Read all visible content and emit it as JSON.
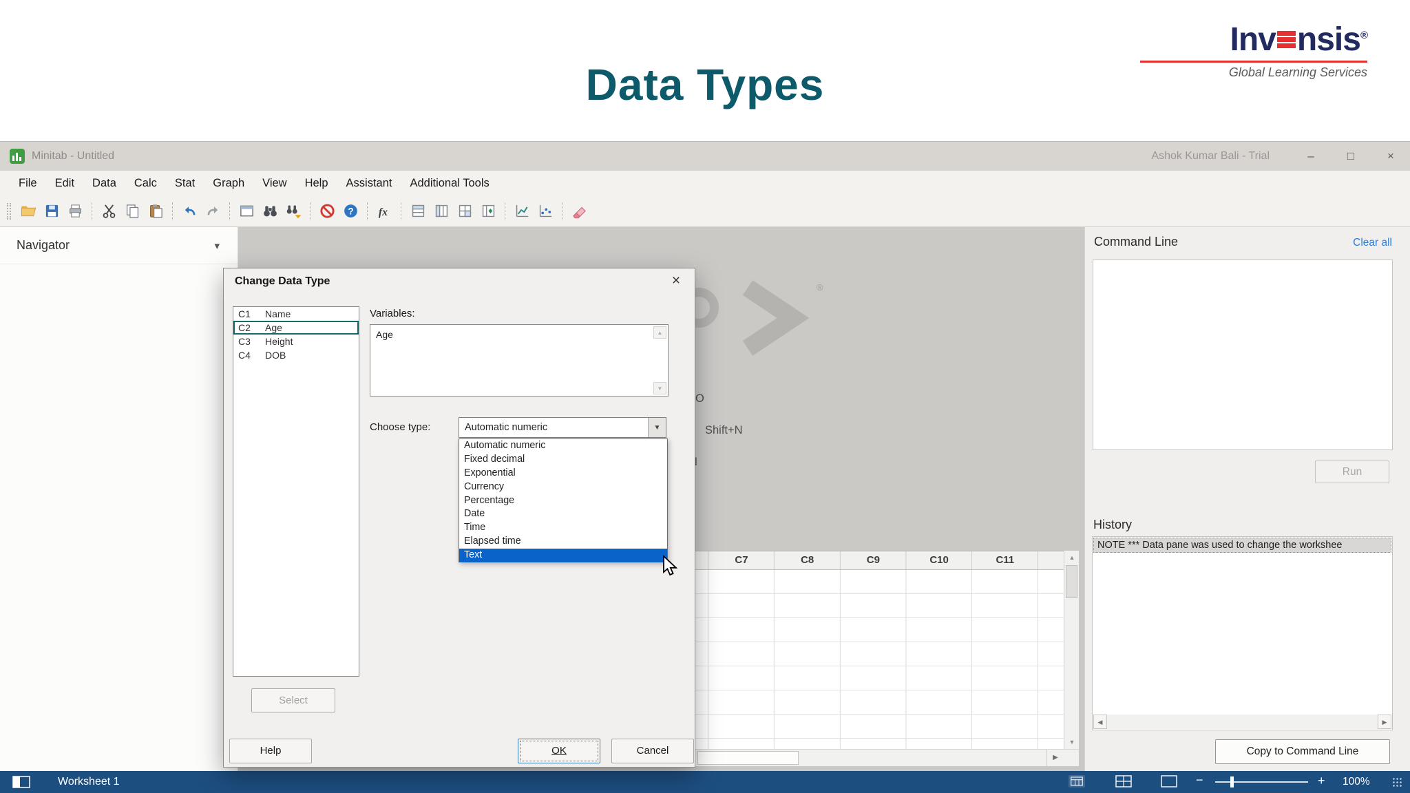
{
  "header": {
    "title": "Data Types",
    "logo": {
      "word_start": "Inv",
      "word_end": "nsis",
      "registered": "®",
      "tagline": "Global Learning Services"
    }
  },
  "titlebar": {
    "app_title": "Minitab - Untitled",
    "account": "Ashok Kumar Bali - Trial",
    "minimize": "–",
    "maximize": "□",
    "close": "×"
  },
  "menubar": {
    "items": [
      "File",
      "Edit",
      "Data",
      "Calc",
      "Stat",
      "Graph",
      "View",
      "Help",
      "Assistant",
      "Additional Tools"
    ]
  },
  "toolbar": {
    "icons": [
      "open-file",
      "save",
      "print",
      "cut",
      "copy",
      "paste",
      "undo",
      "redo",
      "new-window",
      "find",
      "find-next",
      "cancel",
      "help",
      "insert-function",
      "insert-rows",
      "insert-columns",
      "insert-cells",
      "move-columns",
      "scatterplot",
      "edit-graph",
      "eraser"
    ]
  },
  "navigator": {
    "title": "Navigator"
  },
  "background": {
    "fragments": [
      "O",
      "Shift+N",
      "N"
    ],
    "registered": "®"
  },
  "dialog": {
    "title": "Change Data Type",
    "close": "×",
    "columns": [
      {
        "id": "C1",
        "name": "Name"
      },
      {
        "id": "C2",
        "name": "Age"
      },
      {
        "id": "C3",
        "name": "Height"
      },
      {
        "id": "C4",
        "name": "DOB"
      }
    ],
    "selected_column": "C2",
    "variables_label": "Variables:",
    "variables_value": "Age",
    "choose_type_label": "Choose type:",
    "selected_type": "Automatic numeric",
    "type_options": [
      "Automatic numeric",
      "Fixed decimal",
      "Exponential",
      "Currency",
      "Percentage",
      "Date",
      "Time",
      "Elapsed time",
      "Text"
    ],
    "highlighted_option": "Text",
    "buttons": {
      "select": "Select",
      "help": "Help",
      "ok": "OK",
      "cancel": "Cancel"
    }
  },
  "command_line": {
    "title": "Command Line",
    "clear_all": "Clear all",
    "run": "Run"
  },
  "history": {
    "title": "History",
    "note": "NOTE *** Data pane was used to change the workshee"
  },
  "worksheet": {
    "columns": [
      "C7",
      "C8",
      "C9",
      "C10",
      "C11"
    ],
    "copy_to_command_line": "Copy to Command Line"
  },
  "statusbar": {
    "worksheet_name": "Worksheet 1",
    "zoom": "100%",
    "zoom_minus": "−",
    "zoom_plus": "+"
  }
}
